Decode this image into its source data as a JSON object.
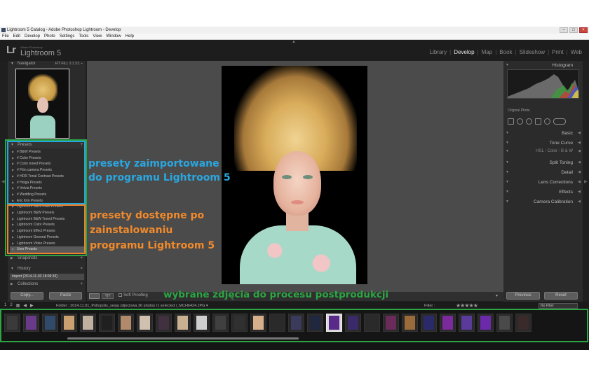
{
  "window": {
    "title": "Lightroom 5 Catalog - Adobe Photoshop Lightroom - Develop",
    "controls": [
      "–",
      "□",
      "×"
    ]
  },
  "menu": [
    "File",
    "Edit",
    "Develop",
    "Photo",
    "Settings",
    "Tools",
    "View",
    "Window",
    "Help"
  ],
  "identity": {
    "logo": "Lr",
    "brand": "Adobe Photoshop",
    "product": "Lightroom 5"
  },
  "modules": [
    {
      "label": "Library",
      "active": false
    },
    {
      "label": "Develop",
      "active": true
    },
    {
      "label": "Map",
      "active": false
    },
    {
      "label": "Book",
      "active": false
    },
    {
      "label": "Slideshow",
      "active": false
    },
    {
      "label": "Print",
      "active": false
    },
    {
      "label": "Web",
      "active": false
    }
  ],
  "left_panel": {
    "navigator": {
      "title": "Navigator",
      "zoom_options": "FIT  FILL  1:1  3:1 ÷"
    },
    "presets": {
      "title": "Presets",
      "items": [
        "# B&W Presets",
        "# Color Presets",
        "# Color toned Presets",
        "# Film camera Presets",
        "# HDR Tonal Contrast Presets",
        "# Holga Presets",
        "# Velvia Presets",
        "# Wedding Presets",
        "Eric Kim Presets",
        "Lightroom B&W Filter Presets",
        "Lightroom B&W Presets",
        "Lightroom B&W Toned Presets",
        "Lightroom Color Presets",
        "Lightroom Effect Presets",
        "Lightroom General Presets",
        "Lightroom Video Presets",
        "User Presets"
      ]
    },
    "snapshots": {
      "title": "Snapshots",
      "action": "+"
    },
    "history": {
      "title": "History",
      "action": "×",
      "item": "Import (2014-11-03 18:09:33)"
    },
    "collections": {
      "title": "Collections",
      "action": "+"
    },
    "copy_label": "Copy...",
    "paste_label": "Paste"
  },
  "toolbar": {
    "soft_proofing": "Soft Proofing",
    "yy": "Y|Y"
  },
  "right_panel": {
    "histogram": {
      "title": "Histogram",
      "original": "Original Photo"
    },
    "sections": [
      "Basic",
      "Tone Curve"
    ],
    "hsl": {
      "hsl": "HSL",
      "color": "Color",
      "bw": "B & W"
    },
    "sections2": [
      "Split Toning",
      "Detail",
      "Lens Corrections",
      "Effects",
      "Camera Calibration"
    ],
    "previous_label": "Previous",
    "reset_label": "Reset"
  },
  "filmstrip": {
    "icons": [
      "1",
      "2",
      "▦",
      "◀",
      "▶"
    ],
    "path": "Folder : 2014.11.01_Pollopolis_sesja zdjeciowa     36 photos /1 selected /_MCH6424.JPG ▾",
    "filter_label": "Filter :",
    "stars": "★★★★★",
    "no_filter": "No Filter"
  },
  "annotations": {
    "imported_line1": "presety zaimportowane",
    "imported_line2": "do programu Lightroom 5",
    "builtin_line1": "presety dostępne po",
    "builtin_line2": "zainstalowaniu",
    "builtin_line3": "programu Lightroom 5",
    "filmstrip_note": "wybrane zdjęcia do procesu postprodukcji"
  },
  "colors": {
    "annotation_blue": "#2aa7e0",
    "annotation_orange": "#f08a2c",
    "annotation_green": "#2ca543"
  }
}
